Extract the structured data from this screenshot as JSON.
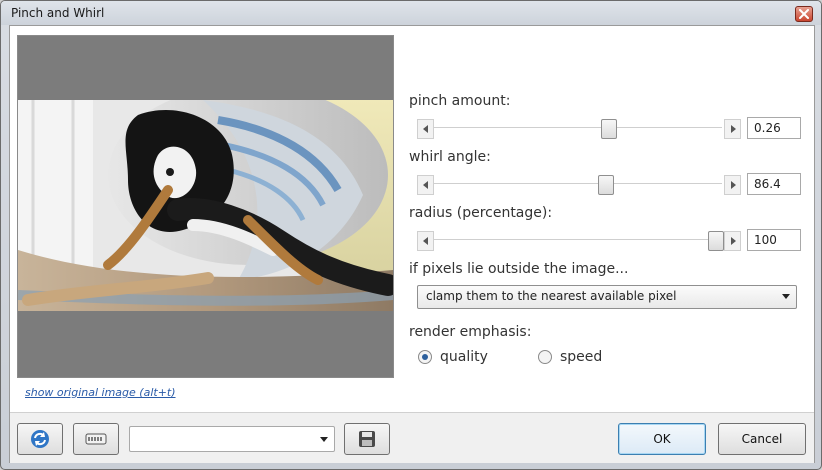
{
  "window": {
    "title": "Pinch and Whirl"
  },
  "preview": {
    "show_original_link": "show original image (alt+t)"
  },
  "controls": {
    "pinch": {
      "label": "pinch amount:",
      "value": "0.26",
      "fraction": 0.61
    },
    "whirl": {
      "label": "whirl angle:",
      "value": "86.4",
      "fraction": 0.6
    },
    "radius": {
      "label": "radius (percentage):",
      "value": "100",
      "fraction": 1.0
    },
    "outside": {
      "label": "if pixels lie outside the image...",
      "selected": "clamp them to the nearest available pixel"
    },
    "render": {
      "label": "render emphasis:",
      "options": [
        {
          "label": "quality",
          "selected": true
        },
        {
          "label": "speed",
          "selected": false
        }
      ]
    }
  },
  "footer": {
    "preset_value": "",
    "ok_label": "OK",
    "cancel_label": "Cancel"
  },
  "icons": {
    "close": "close-icon",
    "refresh": "refresh-icon",
    "randomize": "dice-icon",
    "save": "save-icon"
  },
  "colors": {
    "accent": "#2c5f9c",
    "link": "#2a5ba8",
    "close": "#c9452f",
    "preview_bg": "#7c7c7c"
  }
}
